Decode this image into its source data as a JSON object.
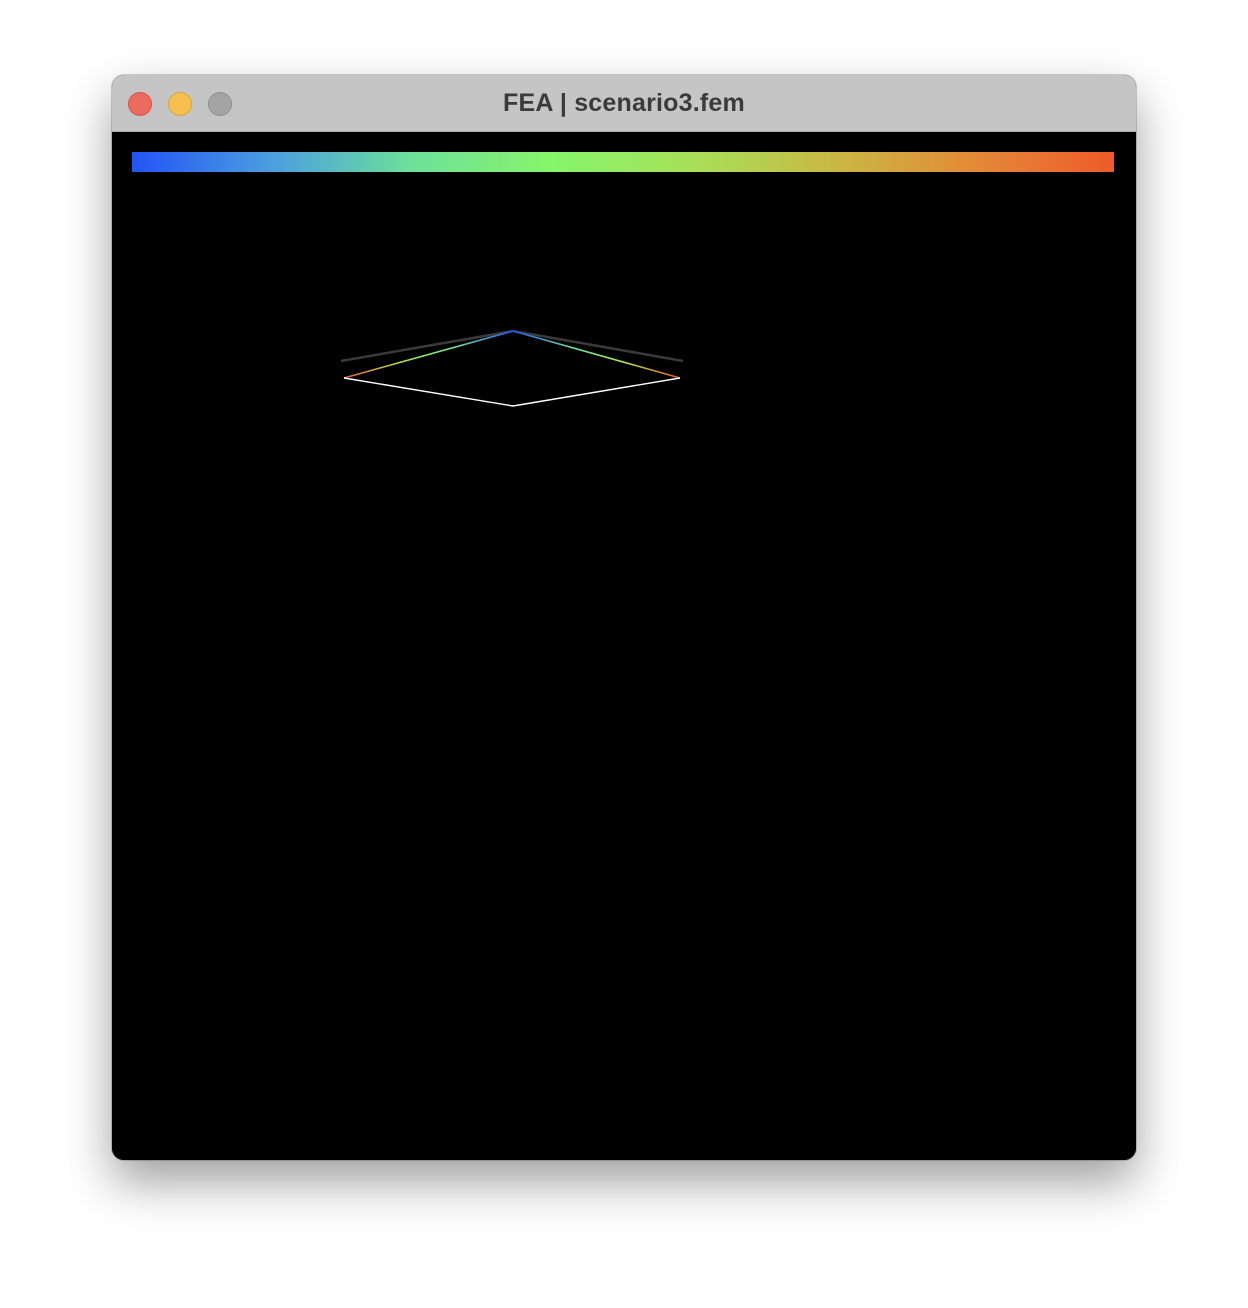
{
  "window": {
    "title": "FEA | scenario3.fem"
  },
  "titlebar": {
    "buttons": [
      {
        "name": "close",
        "color": "#ec6a5e"
      },
      {
        "name": "minimize",
        "color": "#f4bf4f"
      },
      {
        "name": "zoom",
        "color": "#a3a4a3"
      }
    ]
  },
  "colorbar": {
    "stops": [
      "#2353f5",
      "#4a9fe0",
      "#6ee09a",
      "#85f56a",
      "#a8e058",
      "#c9b843",
      "#e48a37",
      "#ef5a2a"
    ]
  },
  "model": {
    "undeformed_color": "#ffffff",
    "reference_color": "#3a3a3a"
  }
}
